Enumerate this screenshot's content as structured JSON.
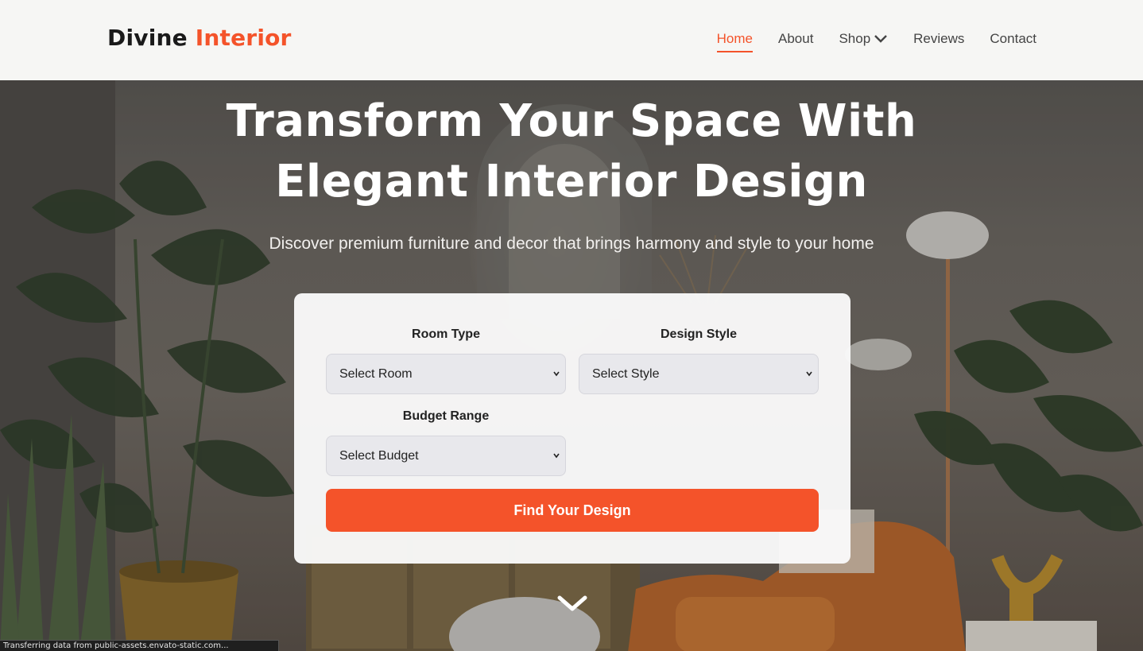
{
  "header": {
    "logo_part1": "Divine",
    "logo_part2": "Interior",
    "nav": [
      {
        "label": "Home",
        "active": true
      },
      {
        "label": "About"
      },
      {
        "label": "Shop",
        "icon": "chevron-down-icon"
      },
      {
        "label": "Reviews"
      },
      {
        "label": "Contact"
      }
    ]
  },
  "hero": {
    "title_line1": "Transform Your Space With",
    "title_line2": "Elegant Interior Design",
    "subtitle": "Discover premium furniture and decor that brings harmony and style to your home"
  },
  "form": {
    "room_label": "Room Type",
    "room_value": "Select Room",
    "style_label": "Design Style",
    "style_value": "Select Style",
    "budget_label": "Budget Range",
    "budget_value": "Select Budget",
    "submit_label": "Find Your Design"
  },
  "scroll_icon": "chevron-down-icon",
  "status_bar": "Transferring data from public-assets.envato-static.com...",
  "colors": {
    "accent": "#f4532a",
    "header_bg": "#f6f6f4",
    "text_dark": "#1a1a1a"
  }
}
